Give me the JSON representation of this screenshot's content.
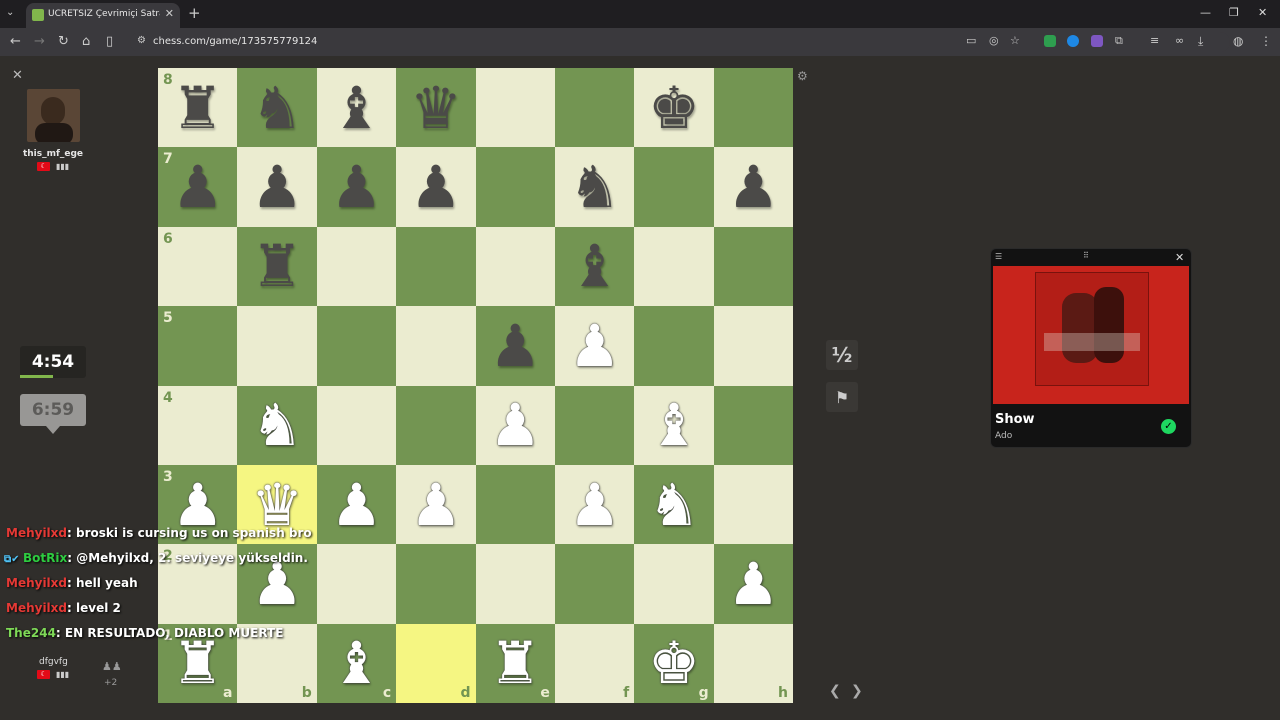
{
  "browser": {
    "tab_title": "ÜCRETSİZ Çevrimiçi Satranç Oy",
    "url": "chess.com/game/173575779124"
  },
  "opponent": {
    "name": "this_mf_ege",
    "flag": "TR"
  },
  "player": {
    "name": "dfgvfg",
    "flag": "TR",
    "captured_extra": "+2"
  },
  "clocks": {
    "top": "4:54",
    "bottom": "6:59"
  },
  "board": {
    "ranks": [
      "8",
      "7",
      "6",
      "5",
      "4",
      "3",
      "2",
      "1"
    ],
    "files": [
      "a",
      "b",
      "c",
      "d",
      "e",
      "f",
      "g",
      "h"
    ],
    "squares": [
      [
        "br",
        "bn",
        "bb",
        "bq",
        "",
        "",
        "bk",
        ""
      ],
      [
        "bp",
        "bp",
        "bp",
        "bp",
        "",
        "bn",
        "",
        "bp"
      ],
      [
        "",
        "br",
        "",
        "",
        "",
        "bb",
        "",
        ""
      ],
      [
        "",
        "",
        "",
        "",
        "bp",
        "wp",
        "",
        ""
      ],
      [
        "",
        "wn",
        "",
        "",
        "wp",
        "",
        "wb",
        ""
      ],
      [
        "wp",
        "wq",
        "wp",
        "wp",
        "",
        "wp",
        "wn",
        ""
      ],
      [
        "",
        "wp",
        "",
        "",
        "",
        "",
        "",
        "wp"
      ],
      [
        "wr",
        "",
        "wb",
        "",
        "wr",
        "",
        "wk",
        ""
      ]
    ],
    "highlighted": [
      "b3",
      "d1"
    ]
  },
  "controls": {
    "draw_label": "½"
  },
  "chat": [
    {
      "user": "Mehyilxd",
      "text": ": broski is cursing us on spanish bro"
    },
    {
      "user": "BotRix",
      "text": ": @Mehyilxd, 2. seviyeye yükseldin."
    },
    {
      "user": "Mehyilxd",
      "text": ": hell yeah"
    },
    {
      "user": "Mehyilxd",
      "text": ": level 2"
    },
    {
      "user": "The244",
      "text": ": EN RESULTADO, DIABLO MUERTE"
    }
  ],
  "music": {
    "title": "Show",
    "artist": "Ado",
    "accent": "#c8241c"
  },
  "colors": {
    "light": "#ebecd0",
    "dark": "#739552",
    "highlight": "#f5f682"
  }
}
